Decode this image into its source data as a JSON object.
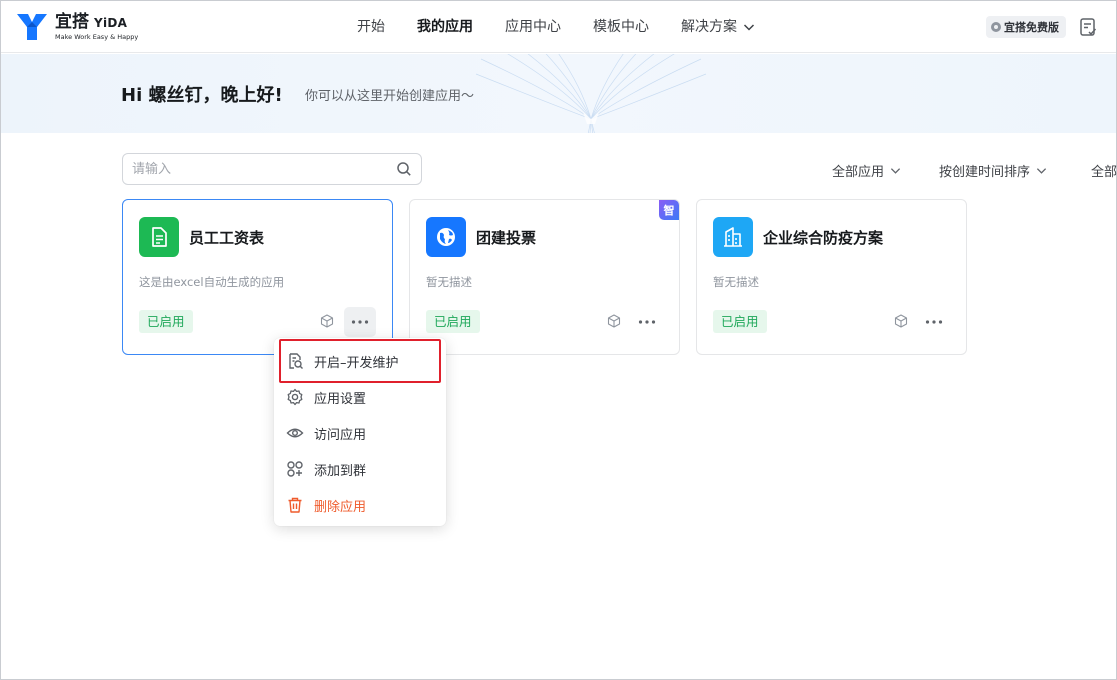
{
  "brand": {
    "name_cn": "宜搭",
    "name_en": "YiDA",
    "slogan": "Make Work Easy & Happy",
    "color": "#1677ff"
  },
  "nav": {
    "items": [
      {
        "label": "开始"
      },
      {
        "label": "我的应用"
      },
      {
        "label": "应用中心"
      },
      {
        "label": "模板中心"
      },
      {
        "label": "解决方案"
      }
    ],
    "active": "我的应用"
  },
  "header": {
    "trial_badge": "宜搭免费版",
    "task_icon": "task-list-icon"
  },
  "banner": {
    "greeting": "Hi 螺丝钉，晚上好!",
    "subtitle": "你可以从这里开始创建应用～"
  },
  "toolbar": {
    "search_placeholder": "请输入",
    "filter_all_apps": "全部应用",
    "sort_by": "按创建时间排序",
    "filter_more": "全部"
  },
  "apps": [
    {
      "title": "员工工资表",
      "desc": "这是由excel自动生成的应用",
      "status": "已启用",
      "icon": "spreadsheet-icon",
      "color": "#1db954"
    },
    {
      "title": "团建投票",
      "desc": "暂无描述",
      "status": "已启用",
      "icon": "globe-icon",
      "color": "#1677ff",
      "badge": "智"
    },
    {
      "title": "企业综合防疫方案",
      "desc": "暂无描述",
      "status": "已启用",
      "icon": "building-icon",
      "color": "#1ea7f5"
    }
  ],
  "context_menu": {
    "items": [
      {
        "label": "开启–开发维护",
        "icon": "dev-maintain-icon"
      },
      {
        "label": "应用设置",
        "icon": "gear-icon"
      },
      {
        "label": "访问应用",
        "icon": "eye-icon"
      },
      {
        "label": "添加到群",
        "icon": "add-group-icon"
      },
      {
        "label": "删除应用",
        "icon": "trash-icon",
        "color": "#ef5b2c"
      }
    ],
    "highlight_color": "#e0202c"
  }
}
